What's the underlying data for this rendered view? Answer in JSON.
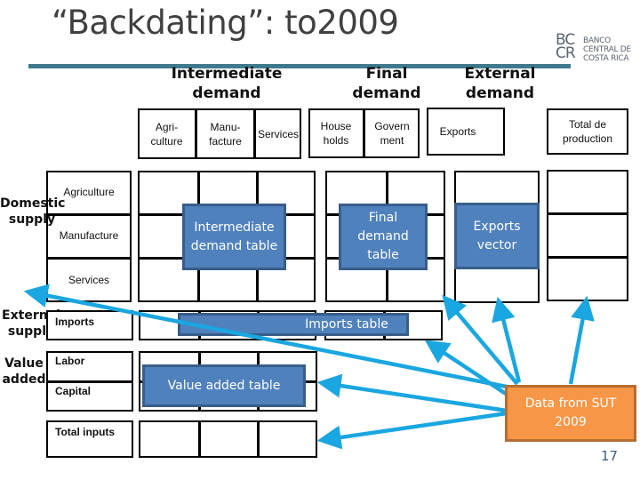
{
  "slide": {
    "title": "“Backdating”: to2009",
    "page_number": "17",
    "logo": {
      "mark": "BC CR",
      "line1": "BANCO",
      "line2": "CENTRAL DE",
      "line3": "COSTA RICA"
    }
  },
  "header_groups": {
    "intermediate": "Intermediate demand",
    "final": "Final demand",
    "external": "External demand"
  },
  "columns": {
    "intermediate": [
      "Agri-\nculture",
      "Manu-\nfacture",
      "Services"
    ],
    "final": [
      "House\nholds",
      "Govern\nment"
    ],
    "exports": "Exports",
    "total": "Total de\nproduction"
  },
  "row_groups": {
    "domestic": "Domestic supply",
    "external": "External supply",
    "value_added": "Value added"
  },
  "rows": {
    "domestic": [
      "Agriculture",
      "Manufacture",
      "Services"
    ],
    "imports": "Imports",
    "value_added": [
      "Labor",
      "Capital"
    ],
    "total": "Total inputs"
  },
  "blocks": {
    "intermediate_table": "Intermediate demand table",
    "final_table": "Final demand table",
    "exports_vector": "Exports vector",
    "imports_table": "Imports table",
    "value_added_table": "Value added table"
  },
  "source_box": {
    "line1": "Data from SUT",
    "line2": "2009"
  },
  "colors": {
    "block_fill": "#4f81bd",
    "block_border": "#385d8a",
    "source_fill": "#f79646",
    "arrow": "#1aa6e0",
    "rule": "#3f7a8c"
  }
}
